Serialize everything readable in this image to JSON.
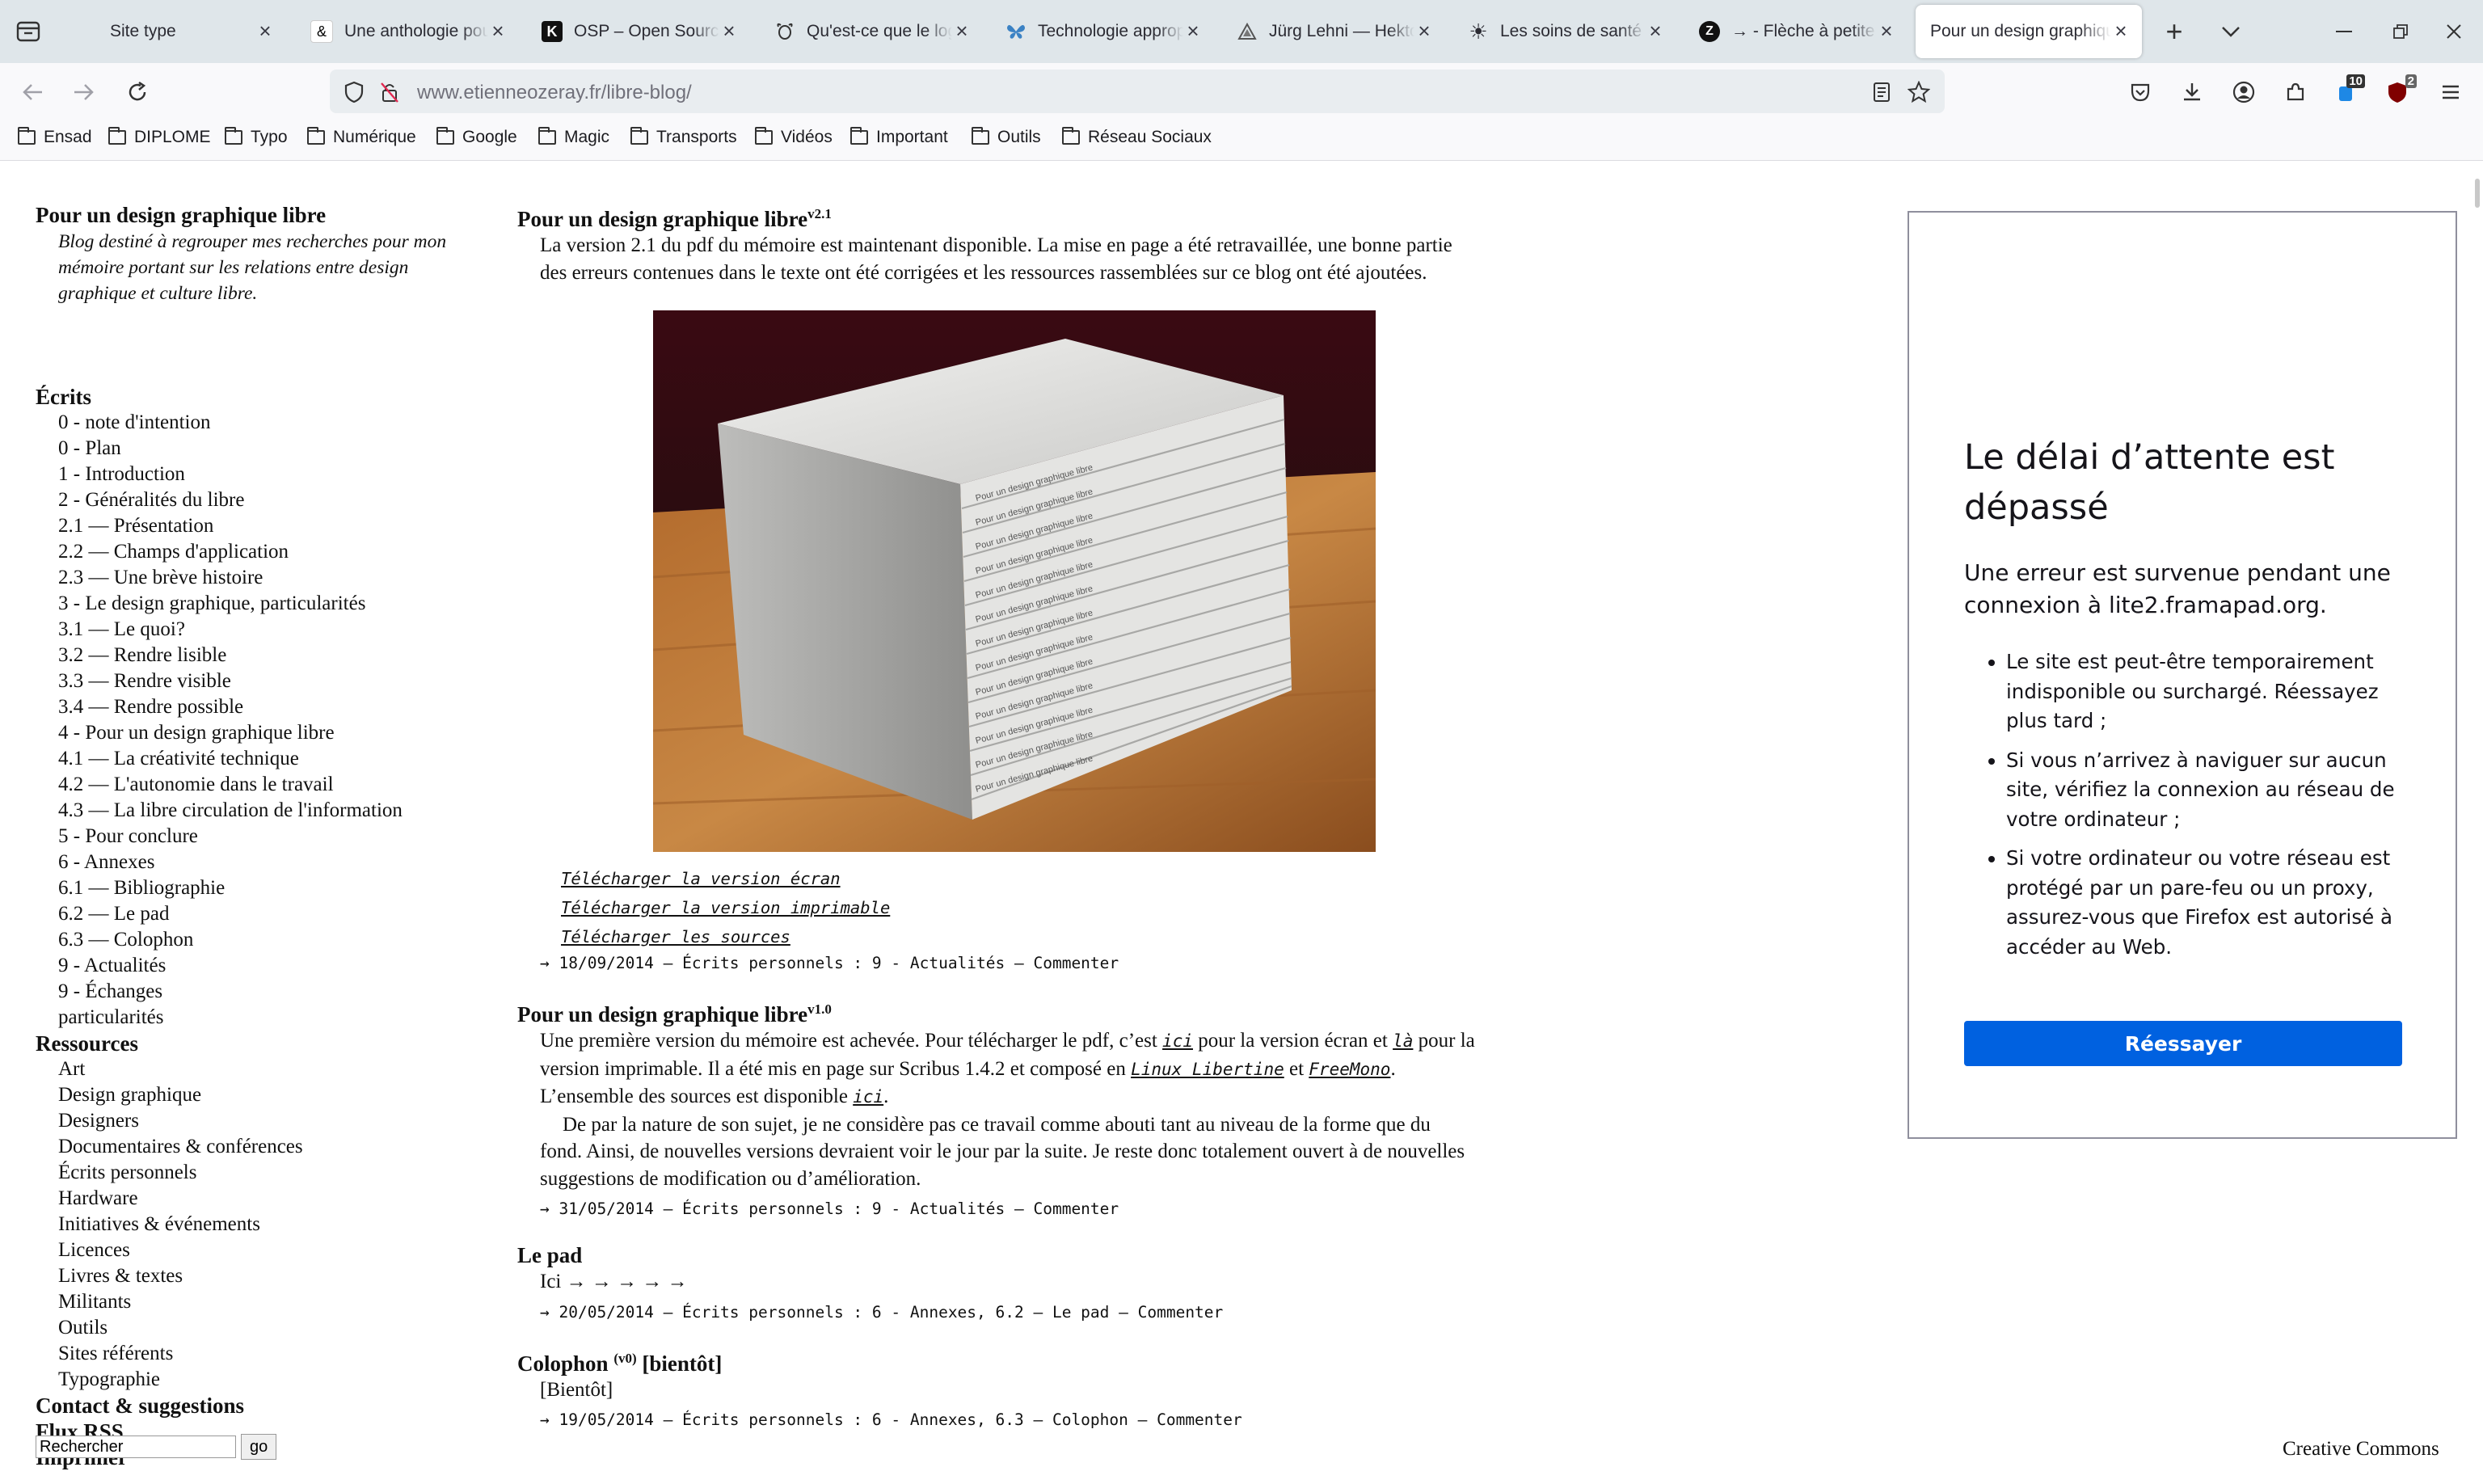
{
  "tabs": [
    {
      "title": "Site type",
      "icon": ""
    },
    {
      "title": "Une anthologie pour",
      "icon": "&"
    },
    {
      "title": "OSP – Open Source",
      "icon": "K"
    },
    {
      "title": "Qu'est-ce que le logiciel",
      "icon": "gnu"
    },
    {
      "title": "Technologie appropriée",
      "icon": "butterfly"
    },
    {
      "title": "Jürg Lehni — Hektor",
      "icon": "triangle"
    },
    {
      "title": "Les soins de santé libres",
      "icon": "sun"
    },
    {
      "title": "→ - Flèche à petite",
      "icon": "Z"
    },
    {
      "title": "Pour un design graphique",
      "icon": ""
    }
  ],
  "toolbar": {
    "url_host": "www.etienneozeray.fr",
    "url_path": "/libre-blog/",
    "badge_a": "10",
    "badge_b": "2"
  },
  "bookmarks": [
    "Ensad",
    "DIPLOME",
    "Typo",
    "Numérique",
    "Google",
    "Magic",
    "Transports",
    "Vidéos",
    "Important",
    "Outils",
    "Réseau Sociaux"
  ],
  "sidebar": {
    "title": "Pour un design graphique libre",
    "description": "Blog destiné à regrouper mes recherches pour mon mémoire portant sur les relations entre design graphique et culture libre.",
    "ecrits_heading": "Écrits",
    "ecrits": [
      "0 - note d'intention",
      "0 - Plan",
      "1 - Introduction",
      "2 - Généralités du libre",
      "2.1 — Présentation",
      "2.2 — Champs d'application",
      "2.3 — Une brève histoire",
      "3 - Le design graphique, particularités",
      "3.1 — Le quoi?",
      "3.2 — Rendre lisible",
      "3.3 — Rendre visible",
      "3.4 — Rendre possible",
      "4 - Pour un design graphique libre",
      "4.1 — La créativité technique",
      "4.2 — L'autonomie dans le travail",
      "4.3 — La libre circulation de l'information",
      "5 - Pour conclure",
      "6 - Annexes",
      "6.1 — Bibliographie",
      "6.2 — Le pad",
      "6.3 — Colophon",
      "9 - Actualités",
      "9 - Échanges"
    ],
    "wrap_word": "particularités",
    "ressources_heading": "Ressources",
    "ressources": [
      "Art",
      "Design graphique",
      "Designers",
      "Documentaires & conférences",
      "Écrits personnels",
      "Hardware",
      "Initiatives & événements",
      "Licences",
      "Livres & textes",
      "Militants",
      "Outils",
      "Sites référents",
      "Typographie"
    ],
    "contact": "Contact & suggestions",
    "flux": "Flux RSS",
    "imprimer": "Imprimer",
    "search_value": "Rechercher",
    "search_button": "go"
  },
  "posts": {
    "p1": {
      "title": "Pour un design graphique libre",
      "version": "v2.1",
      "body": "La version 2.1 du pdf du mémoire est maintenant disponible. La mise en page a été retravaillée, une bonne partie des erreurs contenues dans le texte ont été corrigées et les ressources rassemblées sur ce blog ont été ajoutées.",
      "links": [
        "Télécharger la version écran",
        "Télécharger la version imprimable",
        "Télécharger les sources"
      ],
      "meta": "→ 18/09/2014 — Écrits personnels : 9 - Actualités — Commenter",
      "book_spine": "Pour un design graphique libre"
    },
    "p2": {
      "title": "Pour un design graphique libre",
      "version": "v1.0",
      "t1": "Une première version du mémoire est achevée. Pour télécharger le pdf, c’est ",
      "c1": "ici",
      "t2": " pour la version écran et ",
      "c2": "là",
      "t3": " pour la version imprimable. Il a été mis en page sur Scribus 1.4.2 et composé en ",
      "c3": "Linux Libertine",
      "t4": " et ",
      "c4": "FreeMono",
      "t5": ". L’ensemble des sources est disponible ",
      "c5": "ici",
      "t6": ".",
      "body2": "De par la nature de son sujet, je ne considère pas ce travail comme abouti tant au niveau de la forme que du fond. Ainsi, de nouvelles versions devraient voir le jour par la suite. Je reste donc totalement ouvert à de nouvelles suggestions de modification ou d’amélioration.",
      "meta": "→ 31/05/2014 — Écrits personnels : 9 - Actualités — Commenter"
    },
    "p3": {
      "title": "Le pad",
      "body": "Ici → → → → →",
      "meta": "→ 20/05/2014 — Écrits personnels : 6 - Annexes, 6.2 — Le pad — Commenter"
    },
    "p4": {
      "title": "Colophon",
      "version": "(v0)",
      "suffix": "[bientôt]",
      "body": "[Bientôt]",
      "meta": "→ 19/05/2014 — Écrits personnels : 6 - Annexes, 6.3 — Colophon — Commenter"
    }
  },
  "error_panel": {
    "title": "Le délai d’attente est dépassé",
    "description": "Une erreur est survenue pendant une connexion à lite2.framapad.org.",
    "items": [
      "Le site est peut-être temporairement indisponible ou surchargé. Réessayez plus tard ;",
      "Si vous n’arrivez à naviguer sur aucun site, vérifiez la connexion au réseau de votre ordinateur ;",
      "Si votre ordinateur ou votre réseau est protégé par un pare-feu ou un proxy, assurez-vous que Firefox est autorisé à accéder au Web."
    ],
    "button": "Réessayer"
  },
  "footer": {
    "cc": "Creative Commons"
  },
  "colors": {
    "accent": "#0061e0",
    "tabbar": "#dfe6ea",
    "chrome": "#f9f9fb"
  }
}
